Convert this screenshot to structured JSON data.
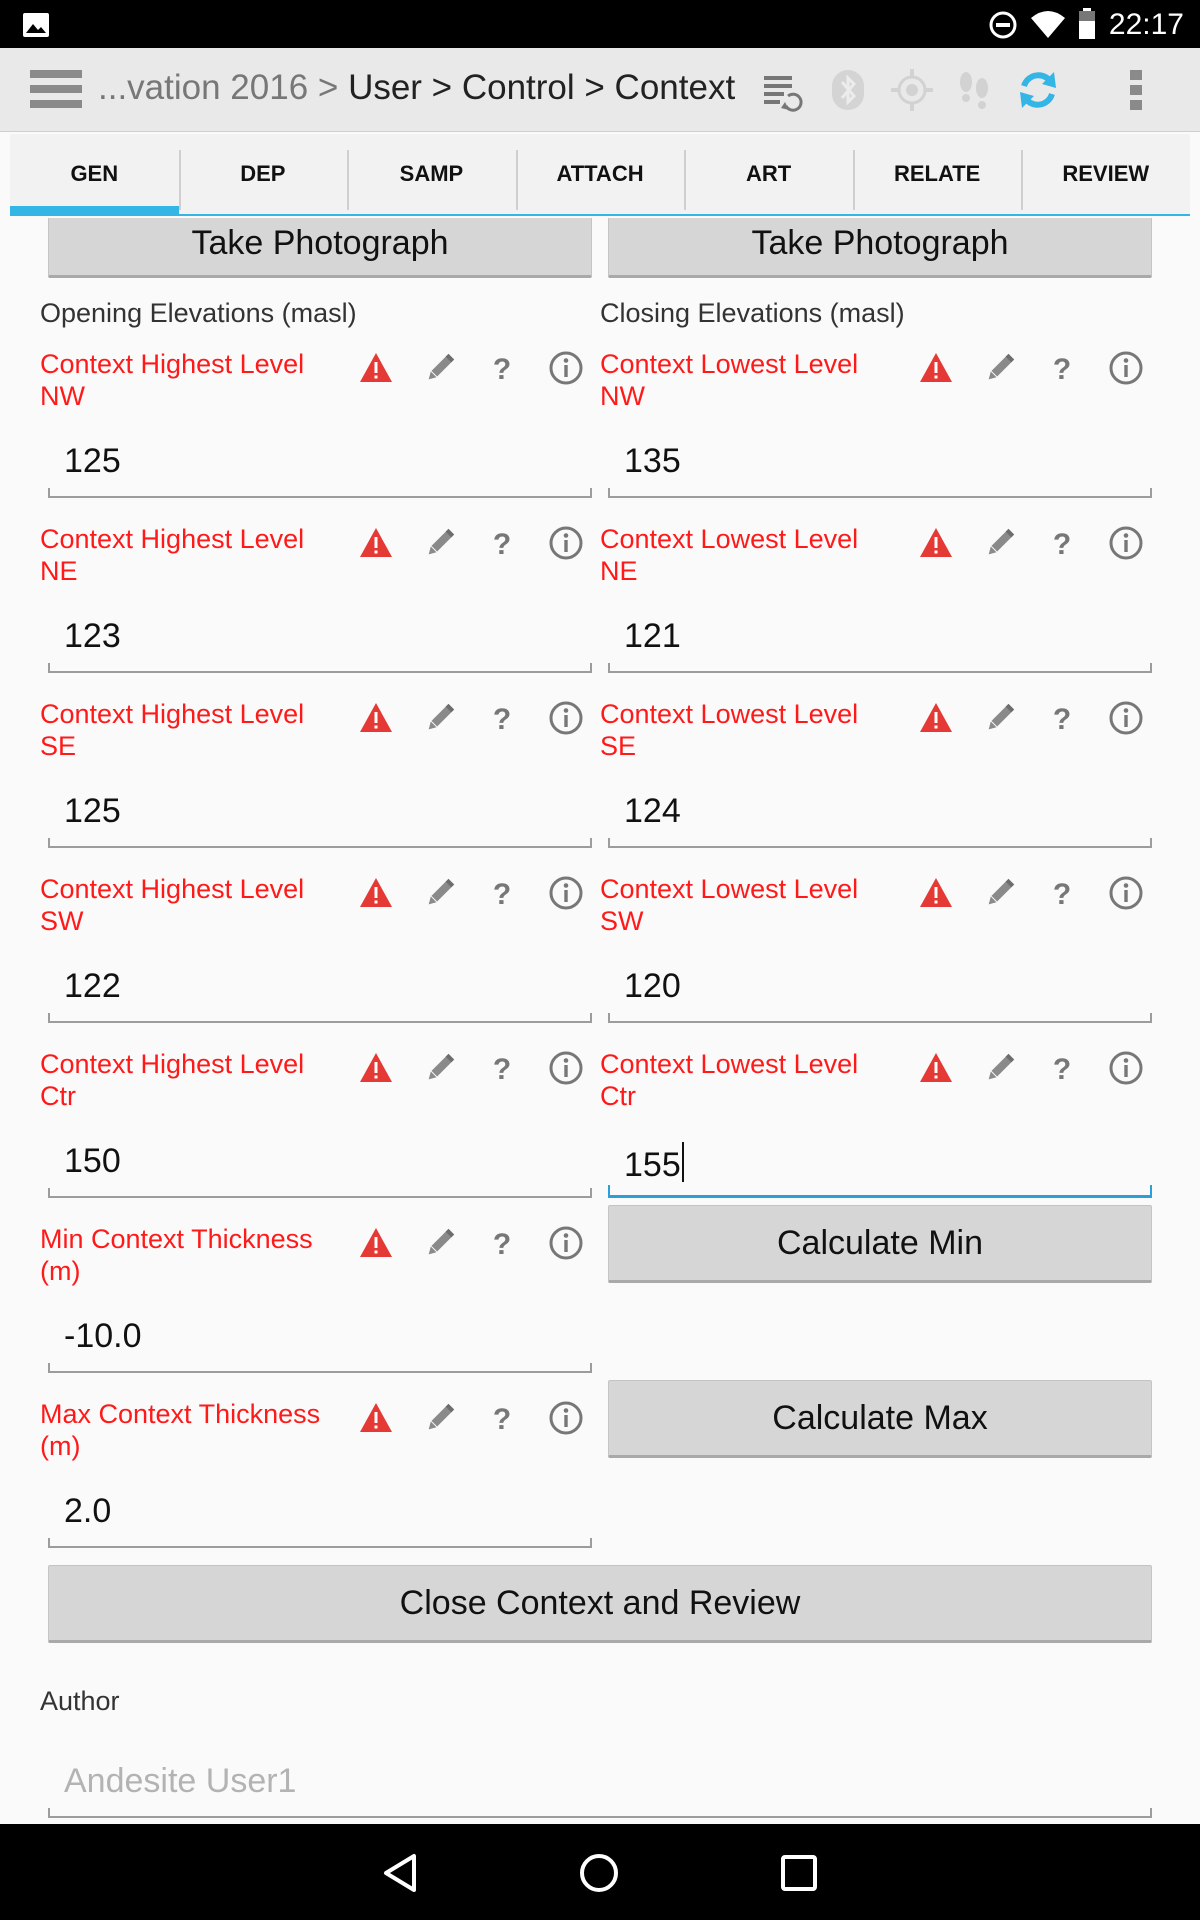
{
  "statusbar": {
    "time": "22:17"
  },
  "actionbar": {
    "crumb_prefix": "...vation 2016 >",
    "crumb_path": "User > Control > Context"
  },
  "tabs": [
    "GEN",
    "DEP",
    "SAMP",
    "ATTACH",
    "ART",
    "RELATE",
    "REVIEW"
  ],
  "photo_buttons": {
    "left": "Take Photograph",
    "right": "Take Photograph"
  },
  "sections": {
    "opening": "Opening Elevations (masl)",
    "closing": "Closing Elevations (masl)"
  },
  "opening_fields": [
    {
      "label": "Context Highest Level NW",
      "value": "125"
    },
    {
      "label": "Context Highest Level NE",
      "value": "123"
    },
    {
      "label": "Context Highest Level SE",
      "value": "125"
    },
    {
      "label": "Context Highest Level SW",
      "value": "122"
    },
    {
      "label": "Context Highest Level Ctr",
      "value": "150"
    }
  ],
  "closing_fields": [
    {
      "label": "Context Lowest Level NW",
      "value": "135"
    },
    {
      "label": "Context Lowest Level NE",
      "value": "121"
    },
    {
      "label": "Context Lowest Level SE",
      "value": "124"
    },
    {
      "label": "Context Lowest Level SW",
      "value": "120"
    },
    {
      "label": "Context Lowest Level Ctr",
      "value": "155"
    }
  ],
  "thickness": {
    "min_label": "Min Context Thickness (m)",
    "min_value": "-10.0",
    "min_button": "Calculate Min",
    "max_label": "Max Context Thickness (m)",
    "max_value": "2.0",
    "max_button": "Calculate Max"
  },
  "close_button": "Close Context and Review",
  "author": {
    "label": "Author",
    "placeholder": "Andesite User1"
  },
  "icons": {
    "warning": "warning-icon",
    "edit": "pencil-icon",
    "help": "question-icon",
    "info": "info-icon"
  },
  "colors": {
    "accent": "#33b5e5",
    "error_text": "#ff1a1a",
    "warning": "#e53935"
  }
}
